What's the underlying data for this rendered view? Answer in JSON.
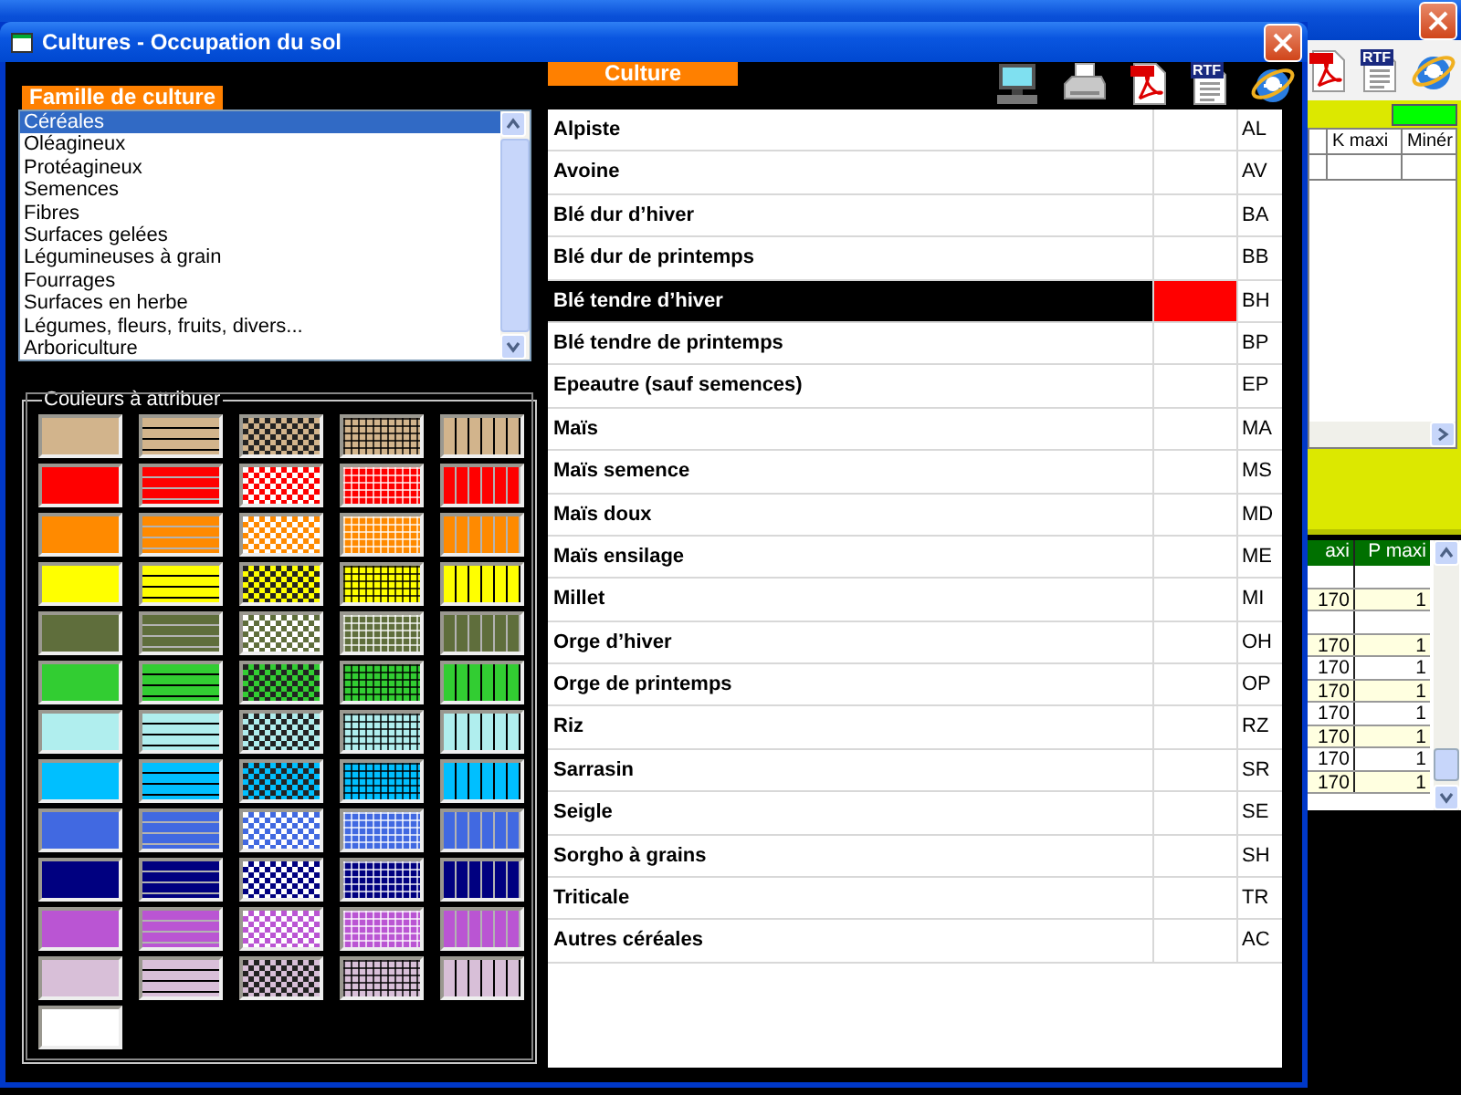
{
  "background_window": {
    "toolbar": [
      {
        "kind": "pdf"
      },
      {
        "kind": "rtf",
        "label": "RTF"
      },
      {
        "kind": "browser"
      }
    ],
    "upper_table": {
      "columns": [
        "K maxi",
        "Minér"
      ]
    },
    "lower_table": {
      "columns": [
        "axi",
        "P maxi"
      ],
      "rows": [
        {
          "cells": [
            "",
            ""
          ]
        },
        {
          "cells": [
            "170",
            "1"
          ]
        },
        {
          "cells": [
            "",
            ""
          ]
        },
        {
          "cells": [
            "170",
            "1"
          ]
        },
        {
          "cells": [
            "170",
            "1"
          ]
        },
        {
          "cells": [
            "170",
            "1"
          ]
        },
        {
          "cells": [
            "170",
            "1"
          ]
        },
        {
          "cells": [
            "170",
            "1"
          ]
        },
        {
          "cells": [
            "170",
            "1"
          ]
        },
        {
          "cells": [
            "170",
            "1"
          ]
        }
      ]
    }
  },
  "dialog": {
    "title": "Cultures - Occupation du sol",
    "toolbar": [
      {
        "kind": "screen"
      },
      {
        "kind": "print"
      },
      {
        "kind": "pdf"
      },
      {
        "kind": "rtf",
        "label": "RTF"
      },
      {
        "kind": "browser"
      }
    ],
    "families": {
      "header": "Famille de culture",
      "items": [
        {
          "label": "Céréales",
          "selected": true
        },
        {
          "label": "Oléagineux",
          "selected": false
        },
        {
          "label": "Protéagineux",
          "selected": false
        },
        {
          "label": "Semences",
          "selected": false
        },
        {
          "label": "Fibres",
          "selected": false
        },
        {
          "label": "Surfaces gelées",
          "selected": false
        },
        {
          "label": "Légumineuses à grain",
          "selected": false
        },
        {
          "label": "Fourrages",
          "selected": false
        },
        {
          "label": "Surfaces en herbe",
          "selected": false
        },
        {
          "label": "Légumes, fleurs, fruits, divers...",
          "selected": false
        },
        {
          "label": "Arboriculture",
          "selected": false
        }
      ]
    },
    "palette": {
      "title": "Couleurs à attribuer",
      "rows": [
        {
          "color": "#d2b48c",
          "swatches": [
            {
              "kind": "solid"
            },
            {
              "kind": "hlines"
            },
            {
              "kind": "checks"
            },
            {
              "kind": "grid"
            },
            {
              "kind": "vlines"
            }
          ]
        },
        {
          "color": "#ff0000",
          "swatches": [
            {
              "kind": "solid"
            },
            {
              "kind": "hlines"
            },
            {
              "kind": "checks"
            },
            {
              "kind": "grid"
            },
            {
              "kind": "vlines"
            }
          ]
        },
        {
          "color": "#ff8a00",
          "swatches": [
            {
              "kind": "solid"
            },
            {
              "kind": "hlines"
            },
            {
              "kind": "checks"
            },
            {
              "kind": "grid"
            },
            {
              "kind": "vlines"
            }
          ]
        },
        {
          "color": "#ffff00",
          "swatches": [
            {
              "kind": "solid"
            },
            {
              "kind": "hlines"
            },
            {
              "kind": "checks"
            },
            {
              "kind": "grid"
            },
            {
              "kind": "vlines"
            }
          ]
        },
        {
          "color": "#5f6e3c",
          "swatches": [
            {
              "kind": "solid"
            },
            {
              "kind": "hlines"
            },
            {
              "kind": "checks"
            },
            {
              "kind": "grid"
            },
            {
              "kind": "vlines"
            }
          ]
        },
        {
          "color": "#32cd32",
          "swatches": [
            {
              "kind": "solid"
            },
            {
              "kind": "hlines"
            },
            {
              "kind": "checks"
            },
            {
              "kind": "grid"
            },
            {
              "kind": "vlines"
            }
          ]
        },
        {
          "color": "#b0eeee",
          "swatches": [
            {
              "kind": "solid"
            },
            {
              "kind": "hlines"
            },
            {
              "kind": "checks"
            },
            {
              "kind": "grid"
            },
            {
              "kind": "vlines"
            }
          ]
        },
        {
          "color": "#00bfff",
          "swatches": [
            {
              "kind": "solid"
            },
            {
              "kind": "hlines"
            },
            {
              "kind": "checks"
            },
            {
              "kind": "grid"
            },
            {
              "kind": "vlines"
            }
          ]
        },
        {
          "color": "#4169e1",
          "swatches": [
            {
              "kind": "solid"
            },
            {
              "kind": "hlines"
            },
            {
              "kind": "checks"
            },
            {
              "kind": "grid"
            },
            {
              "kind": "vlines"
            }
          ]
        },
        {
          "color": "#000080",
          "swatches": [
            {
              "kind": "solid"
            },
            {
              "kind": "hlines"
            },
            {
              "kind": "checks"
            },
            {
              "kind": "grid"
            },
            {
              "kind": "vlines"
            }
          ]
        },
        {
          "color": "#ba55d3",
          "swatches": [
            {
              "kind": "solid"
            },
            {
              "kind": "hlines"
            },
            {
              "kind": "checks"
            },
            {
              "kind": "grid"
            },
            {
              "kind": "vlines"
            }
          ]
        },
        {
          "color": "#d8bfd8",
          "swatches": [
            {
              "kind": "solid"
            },
            {
              "kind": "hlines"
            },
            {
              "kind": "checks"
            },
            {
              "kind": "grid"
            },
            {
              "kind": "vlines"
            }
          ]
        },
        {
          "color": "#ffffff",
          "swatches": [
            {
              "kind": "solid"
            }
          ]
        }
      ]
    },
    "cultures": {
      "header": "Culture",
      "rows": [
        {
          "name": "Alpiste",
          "code": "AL",
          "selected": false
        },
        {
          "name": "Avoine",
          "code": "AV",
          "selected": false
        },
        {
          "name": "Blé dur d’hiver",
          "code": "BA",
          "selected": false
        },
        {
          "name": "Blé dur de printemps",
          "code": "BB",
          "selected": false
        },
        {
          "name": "Blé tendre d’hiver",
          "code": "BH",
          "selected": true,
          "color": "#ff0000"
        },
        {
          "name": "Blé tendre de printemps",
          "code": "BP",
          "selected": false
        },
        {
          "name": "Epeautre (sauf semences)",
          "code": "EP",
          "selected": false
        },
        {
          "name": "Maïs",
          "code": "MA",
          "selected": false
        },
        {
          "name": "Maïs semence",
          "code": "MS",
          "selected": false
        },
        {
          "name": "Maïs doux",
          "code": "MD",
          "selected": false
        },
        {
          "name": "Maïs ensilage",
          "code": "ME",
          "selected": false
        },
        {
          "name": "Millet",
          "code": "MI",
          "selected": false
        },
        {
          "name": "Orge d’hiver",
          "code": "OH",
          "selected": false
        },
        {
          "name": "Orge de printemps",
          "code": "OP",
          "selected": false
        },
        {
          "name": "Riz",
          "code": "RZ",
          "selected": false
        },
        {
          "name": "Sarrasin",
          "code": "SR",
          "selected": false
        },
        {
          "name": "Seigle",
          "code": "SE",
          "selected": false
        },
        {
          "name": "Sorgho à grains",
          "code": "SH",
          "selected": false
        },
        {
          "name": "Triticale",
          "code": "TR",
          "selected": false
        },
        {
          "name": "Autres céréales",
          "code": "AC",
          "selected": false
        }
      ]
    }
  }
}
